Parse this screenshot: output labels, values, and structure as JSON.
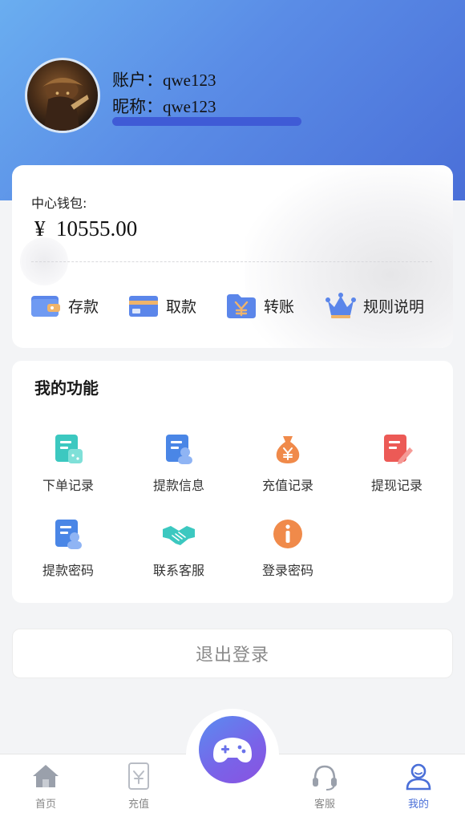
{
  "account": {
    "account_label": "账户：",
    "account_value": "qwe123",
    "nickname_label": "昵称：",
    "nickname_value": "qwe123"
  },
  "wallet": {
    "title": "中心钱包:",
    "currency": "¥",
    "balance": "10555.00",
    "actions": [
      {
        "label": "存款",
        "icon": "wallet-icon"
      },
      {
        "label": "取款",
        "icon": "card-icon"
      },
      {
        "label": "转账",
        "icon": "folder-yen-icon"
      },
      {
        "label": "规则说明",
        "icon": "crown-icon"
      }
    ]
  },
  "functions": {
    "title": "我的功能",
    "items": [
      {
        "label": "下单记录",
        "icon": "order-record-icon",
        "color": "#3cc8c0"
      },
      {
        "label": "提款信息",
        "icon": "withdraw-info-icon",
        "color": "#4a86e6"
      },
      {
        "label": "充值记录",
        "icon": "money-bag-icon",
        "color": "#f08a4a"
      },
      {
        "label": "提现记录",
        "icon": "edit-record-icon",
        "color": "#ec5a56"
      },
      {
        "label": "提款密码",
        "icon": "withdraw-password-icon",
        "color": "#4a86e6"
      },
      {
        "label": "联系客服",
        "icon": "handshake-icon",
        "color": "#3cc8c0"
      },
      {
        "label": "登录密码",
        "icon": "info-icon",
        "color": "#f08a4a"
      }
    ]
  },
  "logout": {
    "label": "退出登录"
  },
  "tabbar": {
    "items": [
      {
        "label": "首页",
        "icon": "home-icon"
      },
      {
        "label": "充值",
        "icon": "recharge-icon"
      },
      {
        "label": "客服",
        "icon": "headset-icon"
      },
      {
        "label": "我的",
        "icon": "user-icon",
        "active": true
      }
    ],
    "center_icon": "gamepad-icon"
  },
  "colors": {
    "header_start": "#6aaef0",
    "header_end": "#4a6fd8",
    "accent": "#4a6fd8"
  }
}
